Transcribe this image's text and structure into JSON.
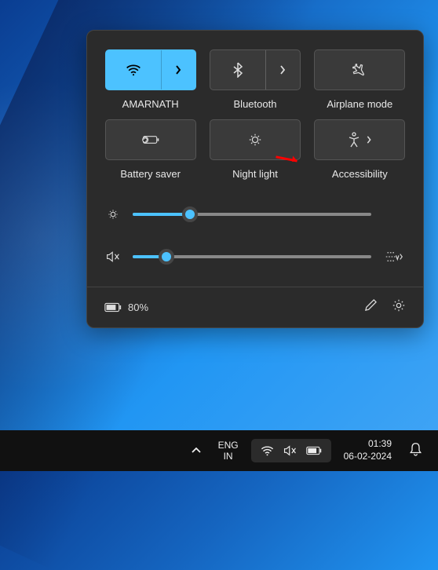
{
  "quick_settings": {
    "tiles": {
      "wifi": {
        "label": "AMARNATH",
        "active": true
      },
      "bluetooth": {
        "label": "Bluetooth",
        "active": false
      },
      "airplane": {
        "label": "Airplane mode",
        "active": false
      },
      "battery_saver": {
        "label": "Battery saver",
        "active": false
      },
      "night_light": {
        "label": "Night light",
        "active": false
      },
      "accessibility": {
        "label": "Accessibility",
        "active": false
      }
    },
    "sliders": {
      "brightness": {
        "value_pct": 24
      },
      "volume": {
        "value_pct": 14,
        "muted": true
      }
    },
    "footer": {
      "battery_pct": "80%"
    }
  },
  "taskbar": {
    "language": {
      "line1": "ENG",
      "line2": "IN"
    },
    "clock": {
      "time": "01:39",
      "date": "06-02-2024"
    }
  },
  "colors": {
    "accent": "#4cc2ff",
    "panel": "#2b2b2b"
  }
}
